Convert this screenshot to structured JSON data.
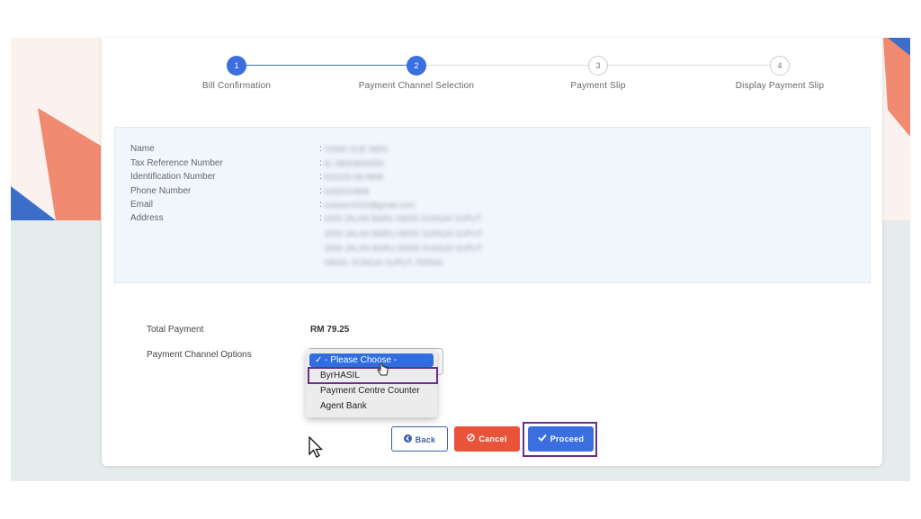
{
  "stepper": [
    {
      "number": "1",
      "label": "Bill Confirmation",
      "state": "done"
    },
    {
      "number": "2",
      "label": "Payment Channel Selection",
      "state": "active"
    },
    {
      "number": "3",
      "label": "Payment Slip",
      "state": "pending"
    },
    {
      "number": "4",
      "label": "Display Payment Slip",
      "state": "pending"
    }
  ],
  "info": {
    "fields": [
      {
        "label": "Name",
        "value": "YONG XUE WEN"
      },
      {
        "label": "Tax Reference Number",
        "value": "IG 28003600050"
      },
      {
        "label": "Identification Number",
        "value": "001015-08-0808"
      },
      {
        "label": "Phone Number",
        "value": "0182010808"
      },
      {
        "label": "Email",
        "value": "xuewen1015@gmail.com"
      },
      {
        "label": "Address",
        "value": "1000 JALAN BARU 09000 SUNGAI SUPUT"
      }
    ],
    "address_extra": [
      "2000 JALAN BARU 09000 SUNGAI SUPUT",
      "3000 JALAN BARU 09000 SUNGAI SUPUT",
      "09000, SUNGAI SUPUT, PERAK"
    ],
    "colon": ":"
  },
  "payment": {
    "total_label": "Total Payment",
    "total_value": "RM 79.25",
    "channel_label": "Payment Channel Options",
    "options": [
      "- Please Choose -",
      "ByrHASIL",
      "Payment Centre Counter",
      "Agent Bank"
    ],
    "selected_mark": "✓"
  },
  "buttons": {
    "back": "Back",
    "cancel": "Cancel",
    "proceed": "Proceed"
  },
  "colors": {
    "primary": "#3b6fe0",
    "danger": "#e8533a",
    "highlight": "#6a2f8c"
  }
}
